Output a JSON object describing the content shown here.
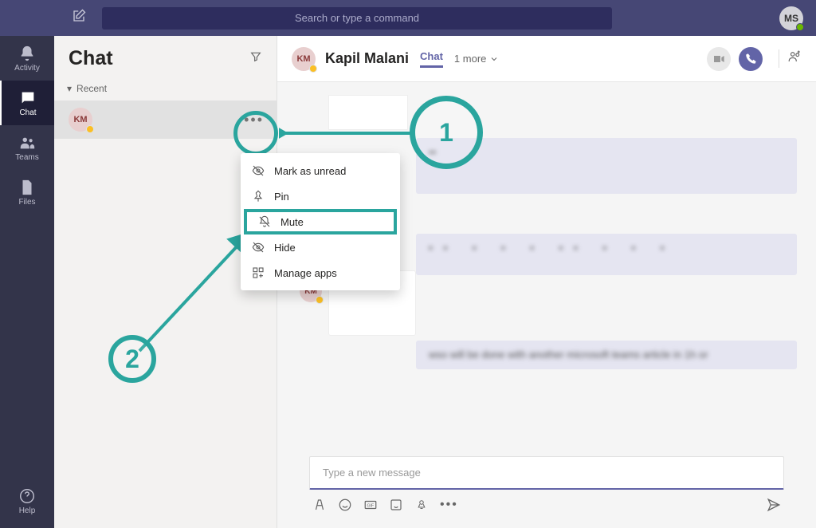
{
  "topbar": {
    "search_placeholder": "Search or type a command",
    "user_initials": "MS"
  },
  "leftrail": {
    "items": [
      {
        "label": "Activity"
      },
      {
        "label": "Chat"
      },
      {
        "label": "Teams"
      },
      {
        "label": "Files"
      }
    ],
    "help_label": "Help"
  },
  "chatlist": {
    "title": "Chat",
    "section_label": "Recent",
    "items": [
      {
        "initials": "KM"
      }
    ]
  },
  "chat_header": {
    "initials": "KM",
    "name": "Kapil Malani",
    "tab_label": "Chat",
    "more_label": "1 more"
  },
  "context_menu": {
    "items": [
      {
        "label": "Mark as unread"
      },
      {
        "label": "Pin"
      },
      {
        "label": "Mute"
      },
      {
        "label": "Hide"
      },
      {
        "label": "Manage apps"
      }
    ]
  },
  "compose": {
    "placeholder": "Type a new message"
  },
  "annotations": {
    "step1": "1",
    "step2": "2"
  },
  "msg_peek": "wso will be done with another microsoft teams article in 1h or"
}
